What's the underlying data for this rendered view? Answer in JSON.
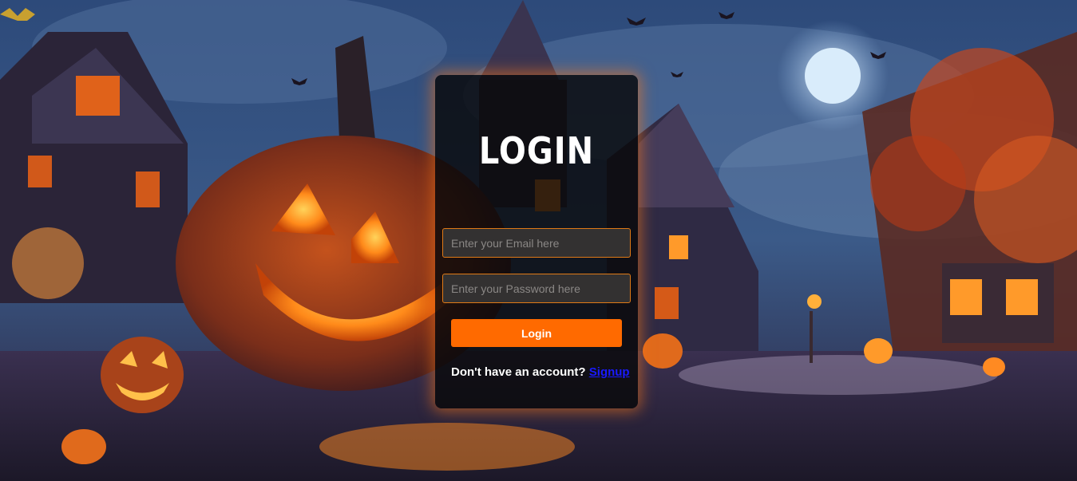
{
  "colors": {
    "accent": "#ff6a00",
    "input_border": "#e07a16",
    "card_background": "#0a0a0c",
    "link": "#1a1aff"
  },
  "login": {
    "title": "Login",
    "email_placeholder": "Enter your Email here",
    "password_placeholder": "Enter your Password here",
    "submit_label": "Login",
    "signup_prompt": "Don't have an account?",
    "signup_link": "Signup"
  }
}
